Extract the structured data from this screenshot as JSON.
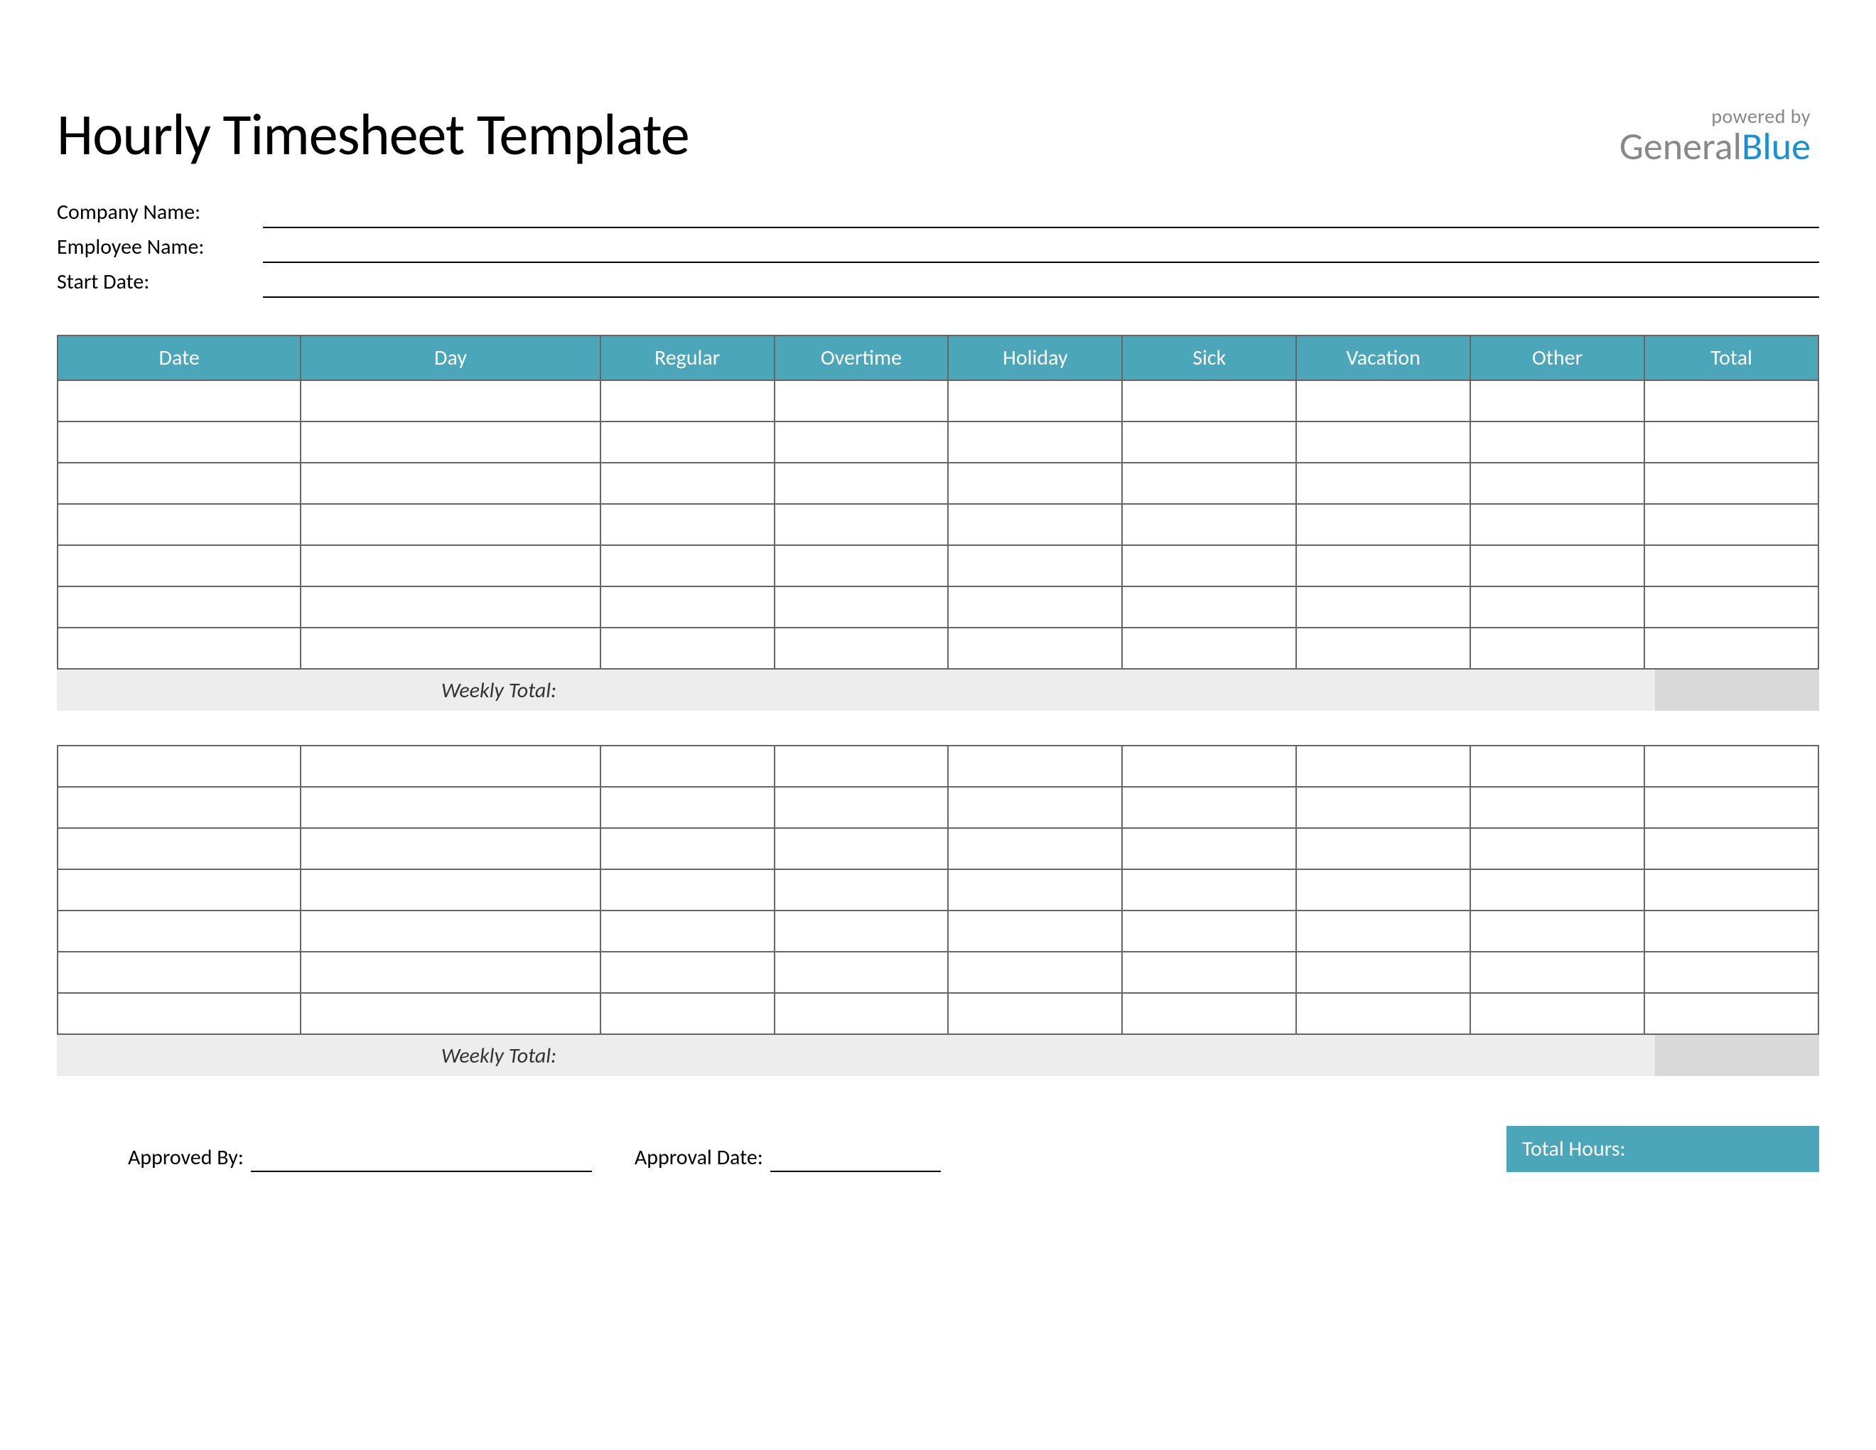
{
  "title": "Hourly Timesheet Template",
  "brand": {
    "powered_by": "powered by",
    "name_a": "General",
    "name_b": "Blue",
    "accent_color": "#1b8fd6"
  },
  "info_fields": {
    "company_label": "Company Name:",
    "employee_label": "Employee Name:",
    "startdate_label": "Start Date:",
    "company_value": "",
    "employee_value": "",
    "startdate_value": ""
  },
  "table": {
    "headers": [
      "Date",
      "Day",
      "Regular",
      "Overtime",
      "Holiday",
      "Sick",
      "Vacation",
      "Other",
      "Total"
    ],
    "week1_rows": [
      [
        "",
        "",
        "",
        "",
        "",
        "",
        "",
        "",
        ""
      ],
      [
        "",
        "",
        "",
        "",
        "",
        "",
        "",
        "",
        ""
      ],
      [
        "",
        "",
        "",
        "",
        "",
        "",
        "",
        "",
        ""
      ],
      [
        "",
        "",
        "",
        "",
        "",
        "",
        "",
        "",
        ""
      ],
      [
        "",
        "",
        "",
        "",
        "",
        "",
        "",
        "",
        ""
      ],
      [
        "",
        "",
        "",
        "",
        "",
        "",
        "",
        "",
        ""
      ],
      [
        "",
        "",
        "",
        "",
        "",
        "",
        "",
        "",
        ""
      ]
    ],
    "week2_rows": [
      [
        "",
        "",
        "",
        "",
        "",
        "",
        "",
        "",
        ""
      ],
      [
        "",
        "",
        "",
        "",
        "",
        "",
        "",
        "",
        ""
      ],
      [
        "",
        "",
        "",
        "",
        "",
        "",
        "",
        "",
        ""
      ],
      [
        "",
        "",
        "",
        "",
        "",
        "",
        "",
        "",
        ""
      ],
      [
        "",
        "",
        "",
        "",
        "",
        "",
        "",
        "",
        ""
      ],
      [
        "",
        "",
        "",
        "",
        "",
        "",
        "",
        "",
        ""
      ],
      [
        "",
        "",
        "",
        "",
        "",
        "",
        "",
        "",
        ""
      ]
    ],
    "weekly_total_label": "Weekly Total:"
  },
  "footer": {
    "approved_by_label": "Approved By:",
    "approval_date_label": "Approval Date:",
    "total_hours_label": "Total Hours:",
    "approved_by_value": "",
    "approval_date_value": "",
    "total_hours_value": ""
  },
  "colors": {
    "header_teal": "#4aa6b8",
    "grey_light": "#ededed",
    "grey_mid": "#d9d9d9"
  }
}
